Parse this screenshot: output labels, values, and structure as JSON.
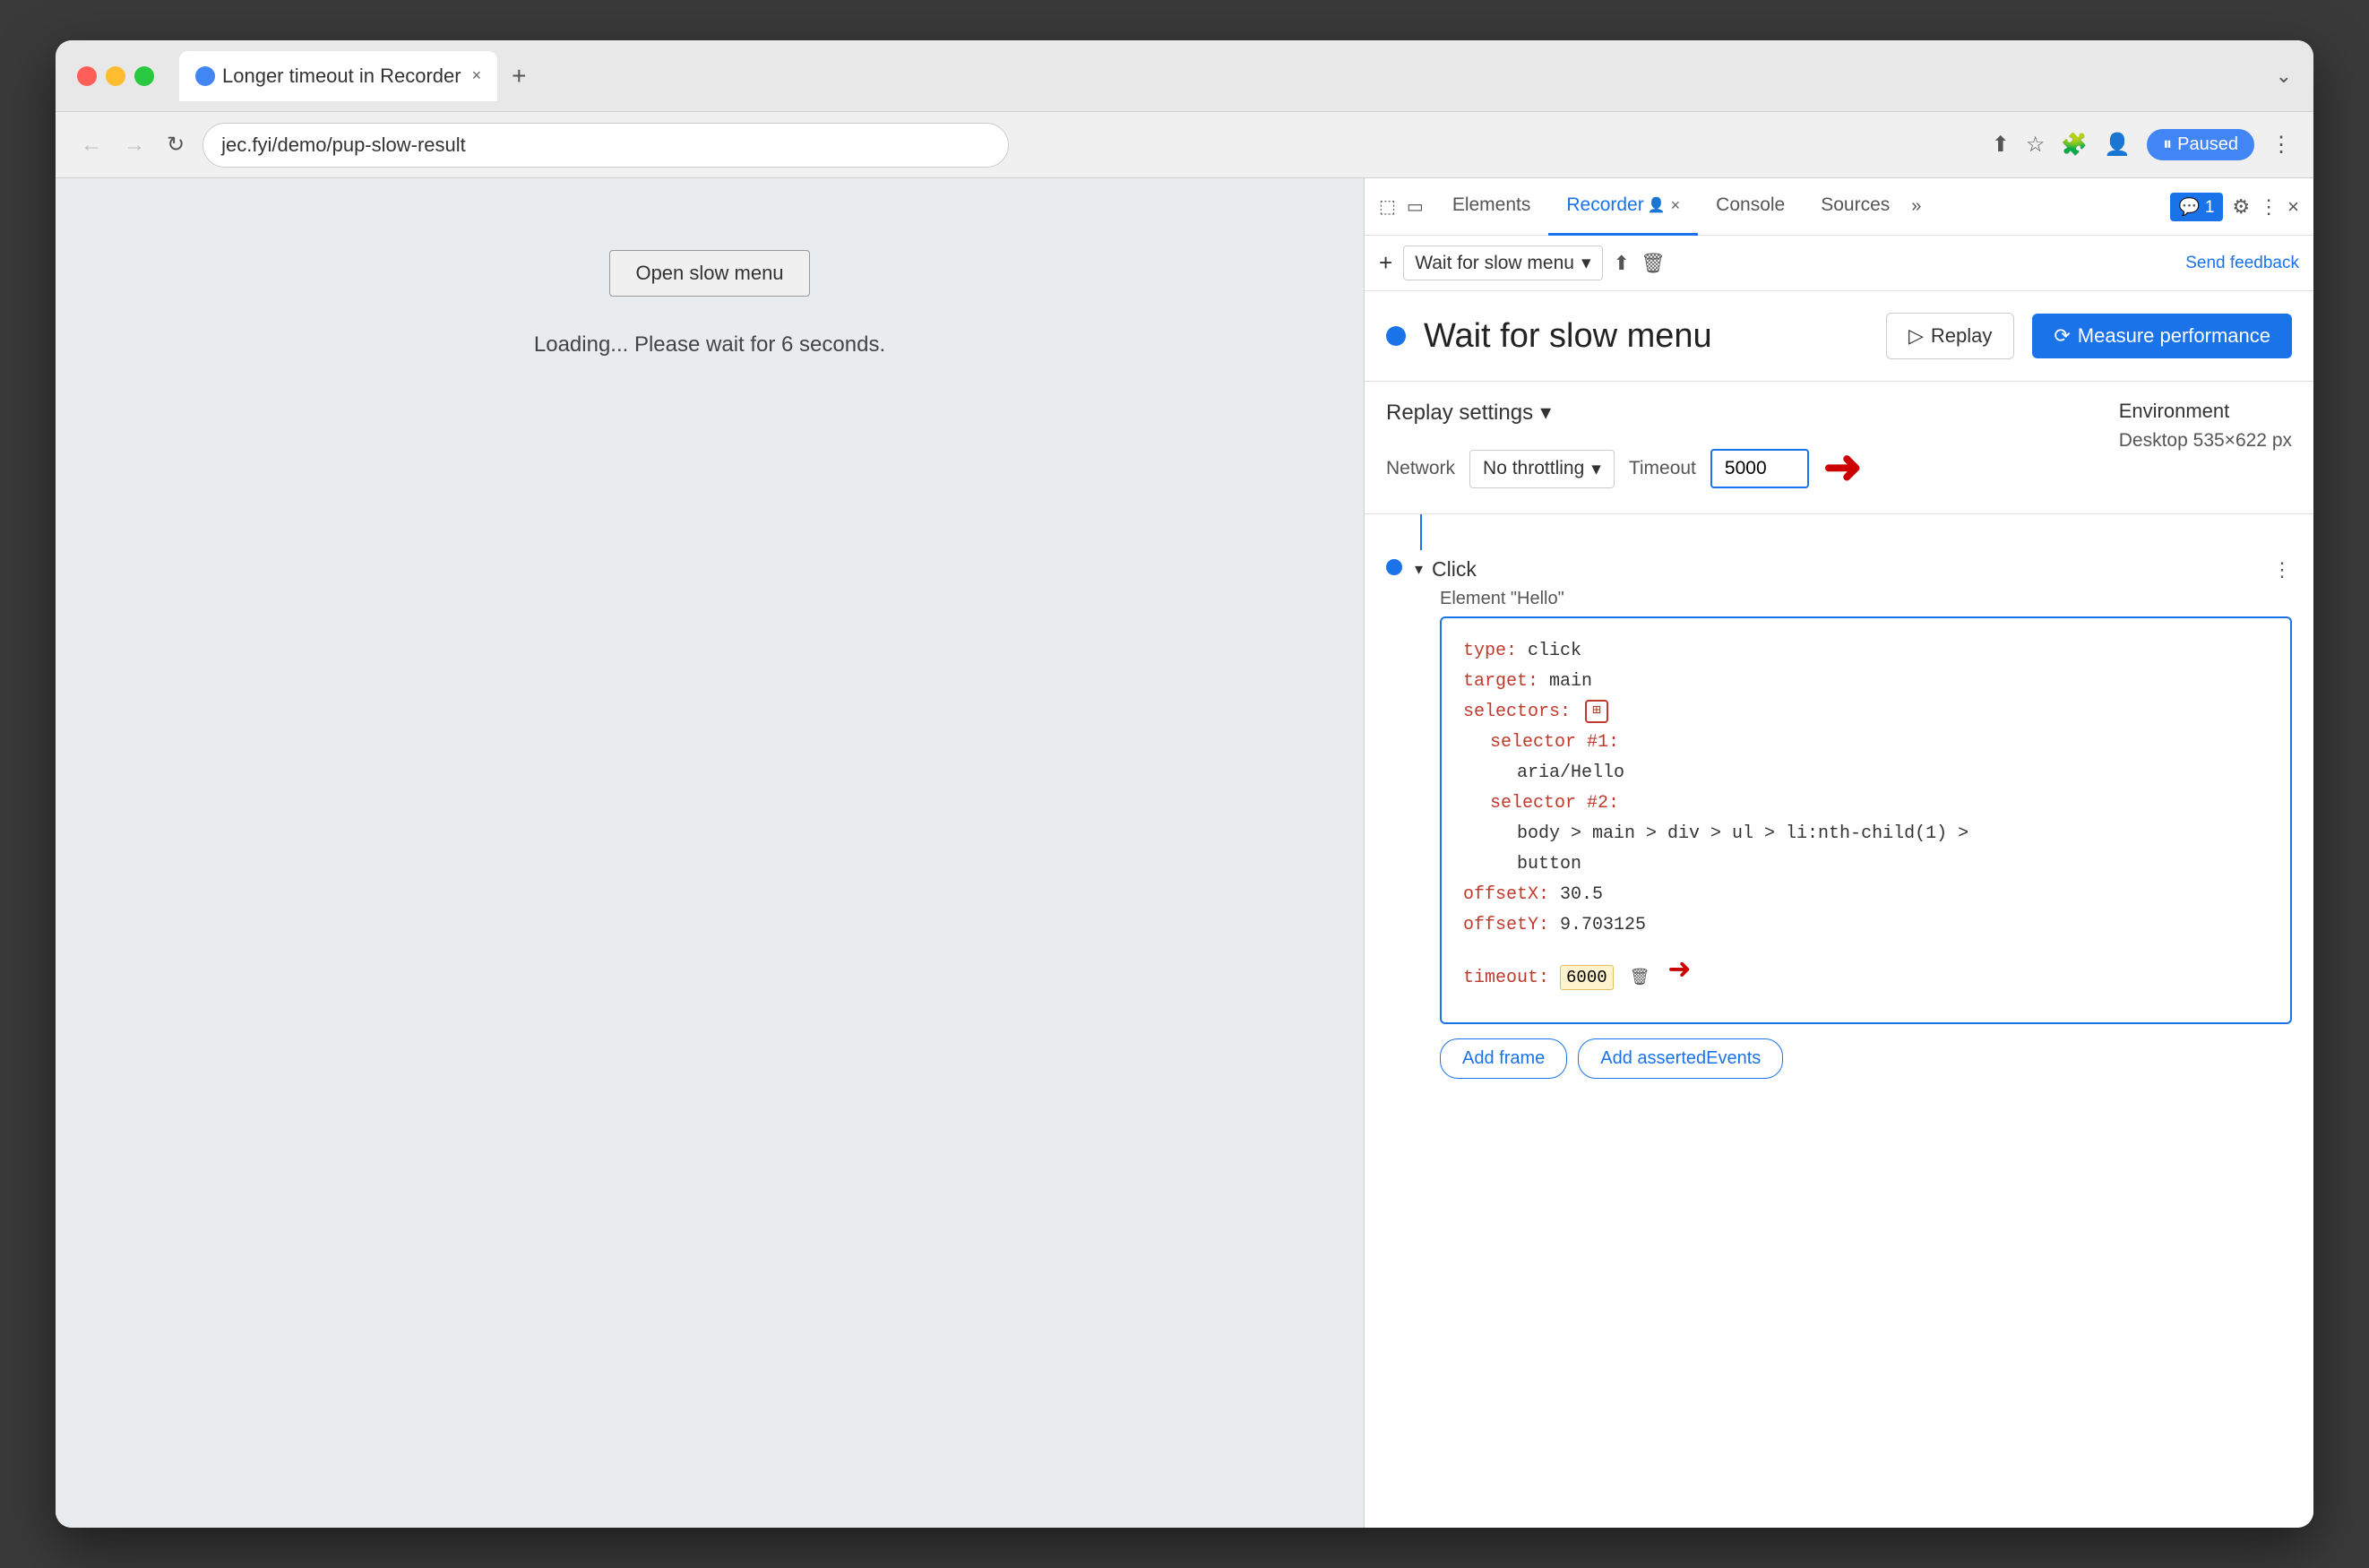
{
  "browser": {
    "tab_title": "Longer timeout in Recorder",
    "tab_close": "×",
    "tab_new": "+",
    "url": "jec.fyi/demo/pup-slow-result",
    "paused_label": "Paused",
    "window_chevron": "⌄"
  },
  "nav": {
    "back": "←",
    "forward": "→",
    "reload": "↻"
  },
  "page": {
    "open_menu_btn": "Open slow menu",
    "loading_text": "Loading... Please wait for 6 seconds."
  },
  "devtools": {
    "tabs": [
      {
        "label": "Elements",
        "active": false
      },
      {
        "label": "Recorder",
        "active": true
      },
      {
        "label": "Console",
        "active": false
      },
      {
        "label": "Sources",
        "active": false
      }
    ],
    "toolbar": {
      "add_btn": "+",
      "recording_name": "Wait for slow menu",
      "send_feedback": "Send feedback"
    },
    "recording_title": "Wait for slow menu",
    "replay_btn": "Replay",
    "measure_btn": "Measure performance",
    "replay_settings": {
      "title": "Replay settings",
      "network_label": "Network",
      "throttle_value": "No throttling",
      "timeout_label": "Timeout",
      "timeout_value": "5000"
    },
    "environment": {
      "title": "Environment",
      "value": "Desktop",
      "dimensions": "535×622 px"
    },
    "step": {
      "type": "Click",
      "description": "Element \"Hello\"",
      "code": {
        "type_key": "type:",
        "type_val": " click",
        "target_key": "target:",
        "target_val": " main",
        "selectors_key": "selectors:",
        "selector1_key": "selector #1:",
        "selector1_val": "aria/Hello",
        "selector2_key": "selector #2:",
        "selector2_val": "body > main > div > ul > li:nth-child(1) >",
        "selector2_val2": "button",
        "offsetX_key": "offsetX:",
        "offsetX_val": " 30.5",
        "offsetY_key": "offsetY:",
        "offsetY_val": " 9.703125",
        "timeout_key": "timeout:",
        "timeout_val": " 6000"
      },
      "btn_add_frame": "Add frame",
      "btn_add_asserted": "Add assertedEvents"
    }
  }
}
